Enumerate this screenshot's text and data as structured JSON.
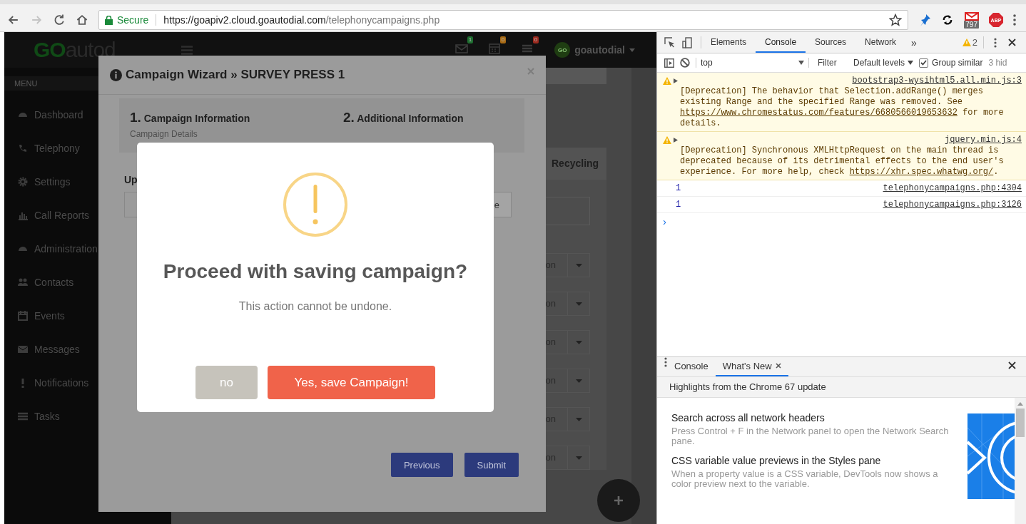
{
  "browser": {
    "nav_buttons": [
      {
        "kind": "back",
        "disabled": false
      },
      {
        "kind": "forward",
        "disabled": true
      },
      {
        "kind": "reload",
        "disabled": false
      },
      {
        "kind": "home",
        "disabled": false
      }
    ],
    "address": {
      "security": "Secure",
      "host": "https://goapiv2.cloud.goautodial.com",
      "path": "/telephonycampaigns.php"
    },
    "extensions": [
      {
        "kind": "pin"
      },
      {
        "kind": "sync"
      },
      {
        "kind": "mail",
        "badge": "797"
      },
      {
        "kind": "adblock",
        "label": "ABP"
      }
    ]
  },
  "app": {
    "logo": {
      "brand": "GO",
      "rest": "autod"
    },
    "notifications": [
      {
        "kind": "mail",
        "count": "1",
        "color": "#1e6e30"
      },
      {
        "kind": "calendar",
        "count": "0",
        "color": "#a86a14"
      },
      {
        "kind": "tasks",
        "count": "0",
        "color": "#9c2a1e"
      }
    ],
    "user": {
      "avatar": "GO",
      "name": "goautodial"
    },
    "sidebar": {
      "heading": "MENU",
      "items": [
        {
          "label": "Dashboard",
          "kind": "dashboard"
        },
        {
          "label": "Telephony",
          "kind": "telephony"
        },
        {
          "label": "Settings",
          "kind": "settings"
        },
        {
          "label": "Call Reports",
          "kind": "reports"
        },
        {
          "label": "Administration",
          "kind": "administration"
        },
        {
          "label": "Contacts",
          "kind": "contacts"
        },
        {
          "label": "Events",
          "kind": "events"
        },
        {
          "label": "Messages",
          "kind": "messages"
        },
        {
          "label": "Notifications",
          "kind": "notifications"
        },
        {
          "label": "Tasks",
          "kind": "tasks"
        }
      ]
    },
    "content": {
      "tab": "Recycling",
      "dropdowns": [
        {
          "value": "on"
        },
        {
          "value": "on"
        },
        {
          "value": "on"
        },
        {
          "value": "on"
        },
        {
          "value": "on"
        },
        {
          "value": "on"
        }
      ]
    }
  },
  "wizard": {
    "title": "Campaign Wizard » SURVEY PRESS 1",
    "steps": [
      {
        "number": "1.",
        "title": "Campaign Information",
        "subtitle": "Campaign Details"
      },
      {
        "number": "2.",
        "title": "Additional Information"
      }
    ],
    "field_label": "Up",
    "field_button": "e",
    "buttons": [
      "Previous",
      "Submit"
    ]
  },
  "dialog": {
    "title": "Proceed with saving campaign?",
    "message": "This action cannot be undone.",
    "cancel": "no",
    "confirm": "Yes, save Campaign!"
  },
  "devtools": {
    "tabs": [
      {
        "label": "Elements",
        "selected": false
      },
      {
        "label": "Console",
        "selected": true
      },
      {
        "label": "Sources",
        "selected": false
      },
      {
        "label": "Network",
        "selected": false
      }
    ],
    "more": "»",
    "warnings": "2",
    "context": "top",
    "filter_placeholder": "Filter",
    "levels": "Default levels",
    "group_similar": {
      "label": "Group similar",
      "checked": true
    },
    "hidden": "3 hid",
    "messages": [
      {
        "kind": "warning",
        "text": "[Deprecation] The behavior that Selection.addRange() merges existing Range and the specified Range was removed. See ",
        "link": "https://www.chromestatus.com/features/6680566019653632",
        "after": " for more details.",
        "source": "bootstrap3-wysihtml5.all.min.js:3"
      },
      {
        "kind": "warning",
        "text": "[Deprecation] Synchronous XMLHttpRequest on the main thread is deprecated because of its detrimental effects to the end user's experience. For more help, check ",
        "link": "https://xhr.spec.whatwg.org/",
        "after": ".",
        "source": "jquery.min.js:4"
      },
      {
        "kind": "log",
        "text": "1",
        "source": "telephonycampaigns.php:4304"
      },
      {
        "kind": "log",
        "text": "1",
        "source": "telephonycampaigns.php:3126"
      }
    ],
    "prompt": "›",
    "drawer": {
      "tabs": [
        {
          "label": "Console",
          "selected": false,
          "closable": false
        },
        {
          "label": "What's New",
          "selected": true,
          "closable": true
        }
      ],
      "banner": "Highlights from the Chrome 67 update",
      "items": [
        {
          "title": "Search across all network headers",
          "description": "Press Control + F in the Network panel to open the Network Search pane."
        },
        {
          "title": "CSS variable value previews in the Styles pane",
          "description": "When a property value is a CSS variable, DevTools now shows a color preview next to the variable."
        }
      ]
    }
  }
}
